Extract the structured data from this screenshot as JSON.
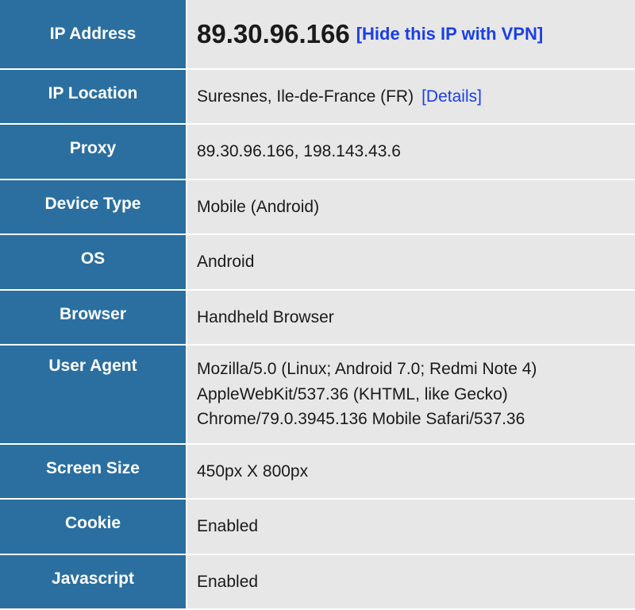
{
  "rows": {
    "ip_address": {
      "label": "IP Address",
      "value": "89.30.96.166",
      "vpn_link": "[Hide this IP with VPN]"
    },
    "ip_location": {
      "label": "IP Location",
      "value": "Suresnes, Ile-de-France (FR)",
      "details_link": "[Details]"
    },
    "proxy": {
      "label": "Proxy",
      "value": "89.30.96.166, 198.143.43.6"
    },
    "device_type": {
      "label": "Device Type",
      "value": "Mobile (Android)"
    },
    "os": {
      "label": "OS",
      "value": "Android"
    },
    "browser": {
      "label": "Browser",
      "value": "Handheld Browser"
    },
    "user_agent": {
      "label": "User Agent",
      "value": "Mozilla/5.0 (Linux; Android 7.0; Redmi Note 4) AppleWebKit/537.36 (KHTML, like Gecko) Chrome/79.0.3945.136 Mobile Safari/537.36"
    },
    "screen_size": {
      "label": "Screen Size",
      "value": "450px X 800px"
    },
    "cookie": {
      "label": "Cookie",
      "value": "Enabled"
    },
    "javascript": {
      "label": "Javascript",
      "value": "Enabled"
    }
  }
}
